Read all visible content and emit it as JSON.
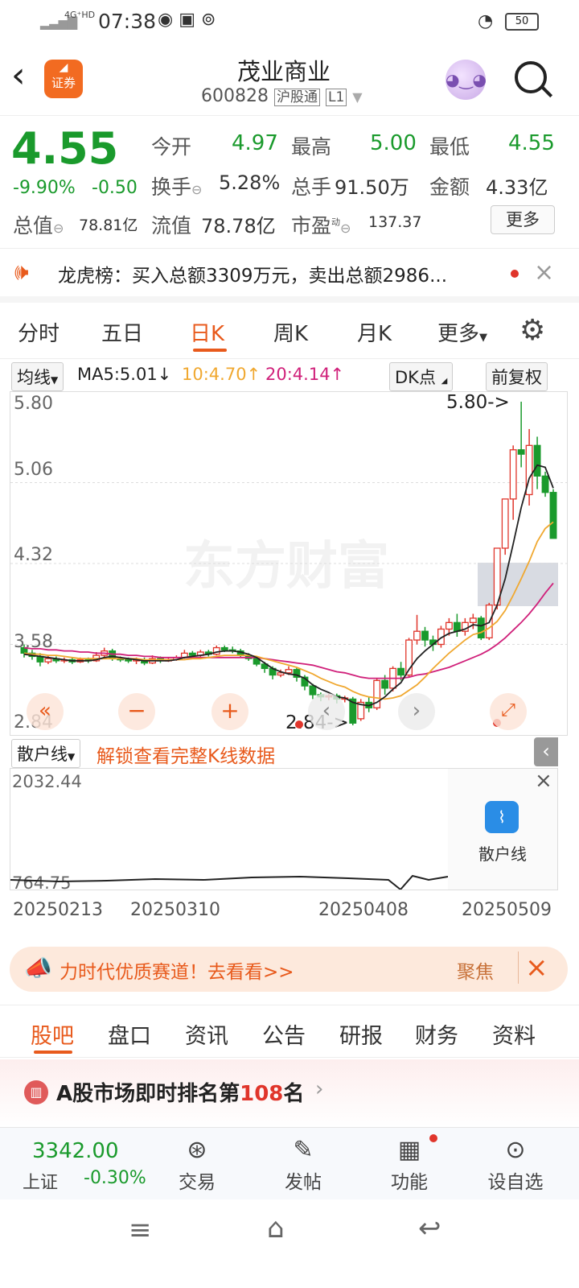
{
  "status_bar": {
    "network": "4G⁺HD",
    "time": "07:38",
    "battery": "50"
  },
  "header": {
    "title": "茂业商业",
    "code": "600828",
    "exchange_tag": "沪股通",
    "level_tag": "L1",
    "logo_label": "证券"
  },
  "quote": {
    "price": "4.55",
    "change_pct": "-9.90%",
    "change": "-0.50",
    "open_label": "今开",
    "open": "4.97",
    "high_label": "最高",
    "high": "5.00",
    "low_label": "最低",
    "low": "4.55",
    "turnover_label": "换手",
    "turnover": "5.28%",
    "volume_label": "总手",
    "volume": "91.50万",
    "amount_label": "金额",
    "amount": "4.33亿",
    "mcap_label": "总值",
    "mcap": "78.81亿",
    "float_label": "流值",
    "float": "78.78亿",
    "pe_label": "市盈",
    "pe_sup": "动",
    "pe": "137.37",
    "more_button": "更多"
  },
  "news": {
    "text": "龙虎榜：买入总额3309万元，卖出总额2986..."
  },
  "chart_tabs": [
    "分时",
    "五日",
    "日K",
    "周K",
    "月K",
    "更多"
  ],
  "active_chart_tab": "日K",
  "ma_row": {
    "selector": "均线",
    "ma5": "MA5:5.01↓",
    "ma10": "10:4.70↑",
    "ma20": "20:4.14↑",
    "dk": "DK点",
    "adjust": "前复权"
  },
  "colors": {
    "up": "#e0352b",
    "down": "#1a9a2c",
    "ma5": "#222222",
    "ma10": "#f0a830",
    "ma20": "#d0207a",
    "accent": "#e85a1c"
  },
  "kline": {
    "y_ticks": [
      "5.80",
      "5.06",
      "4.32",
      "3.58",
      "2.84"
    ],
    "watermark": "东方财富",
    "high_marker": "5.80->",
    "low_marker": "2.84->"
  },
  "chart_data": {
    "type": "candlestick",
    "ylim": [
      2.84,
      5.8
    ],
    "candles": [
      [
        3.55,
        3.5,
        3.58,
        3.46
      ],
      [
        3.5,
        3.47,
        3.53,
        3.44
      ],
      [
        3.47,
        3.42,
        3.5,
        3.38
      ],
      [
        3.42,
        3.45,
        3.48,
        3.4
      ],
      [
        3.45,
        3.43,
        3.47,
        3.41
      ],
      [
        3.43,
        3.44,
        3.46,
        3.41
      ],
      [
        3.44,
        3.42,
        3.46,
        3.4
      ],
      [
        3.42,
        3.44,
        3.46,
        3.41
      ],
      [
        3.44,
        3.43,
        3.46,
        3.41
      ],
      [
        3.43,
        3.48,
        3.51,
        3.42
      ],
      [
        3.48,
        3.52,
        3.55,
        3.46
      ],
      [
        3.52,
        3.45,
        3.54,
        3.43
      ],
      [
        3.45,
        3.44,
        3.47,
        3.42
      ],
      [
        3.44,
        3.43,
        3.46,
        3.41
      ],
      [
        3.43,
        3.44,
        3.46,
        3.4
      ],
      [
        3.44,
        3.41,
        3.46,
        3.39
      ],
      [
        3.41,
        3.45,
        3.48,
        3.4
      ],
      [
        3.45,
        3.43,
        3.47,
        3.41
      ],
      [
        3.43,
        3.44,
        3.46,
        3.42
      ],
      [
        3.44,
        3.46,
        3.48,
        3.43
      ],
      [
        3.46,
        3.5,
        3.53,
        3.45
      ],
      [
        3.5,
        3.48,
        3.52,
        3.46
      ],
      [
        3.48,
        3.51,
        3.53,
        3.46
      ],
      [
        3.51,
        3.49,
        3.53,
        3.47
      ],
      [
        3.49,
        3.55,
        3.57,
        3.48
      ],
      [
        3.55,
        3.53,
        3.57,
        3.51
      ],
      [
        3.53,
        3.52,
        3.56,
        3.5
      ],
      [
        3.52,
        3.48,
        3.54,
        3.46
      ],
      [
        3.48,
        3.45,
        3.5,
        3.43
      ],
      [
        3.45,
        3.4,
        3.47,
        3.38
      ],
      [
        3.4,
        3.36,
        3.42,
        3.32
      ],
      [
        3.36,
        3.3,
        3.38,
        3.26
      ],
      [
        3.3,
        3.32,
        3.35,
        3.28
      ],
      [
        3.32,
        3.35,
        3.38,
        3.3
      ],
      [
        3.35,
        3.28,
        3.37,
        3.24
      ],
      [
        3.28,
        3.2,
        3.3,
        3.16
      ],
      [
        3.2,
        3.12,
        3.22,
        3.08
      ],
      [
        3.12,
        3.1,
        3.14,
        3.06
      ],
      [
        3.1,
        3.11,
        3.13,
        3.07
      ],
      [
        3.11,
        3.08,
        3.13,
        3.04
      ],
      [
        3.08,
        3.09,
        3.11,
        3.05
      ],
      [
        3.08,
        2.86,
        3.1,
        2.84
      ],
      [
        2.9,
        3.05,
        3.08,
        2.88
      ],
      [
        3.05,
        3.0,
        3.1,
        2.96
      ],
      [
        3.0,
        3.25,
        3.27,
        2.98
      ],
      [
        3.25,
        3.18,
        3.3,
        3.12
      ],
      [
        3.18,
        3.36,
        3.38,
        3.15
      ],
      [
        3.36,
        3.3,
        3.42,
        3.25
      ],
      [
        3.3,
        3.62,
        3.64,
        3.28
      ],
      [
        3.62,
        3.7,
        3.85,
        3.58
      ],
      [
        3.7,
        3.62,
        3.74,
        3.56
      ],
      [
        3.62,
        3.58,
        3.66,
        3.52
      ],
      [
        3.58,
        3.72,
        3.75,
        3.55
      ],
      [
        3.72,
        3.78,
        3.82,
        3.66
      ],
      [
        3.78,
        3.7,
        3.86,
        3.65
      ],
      [
        3.7,
        3.78,
        3.82,
        3.66
      ],
      [
        3.78,
        3.82,
        3.86,
        3.72
      ],
      [
        3.82,
        3.64,
        3.84,
        3.62
      ],
      [
        3.64,
        3.94,
        3.96,
        3.62
      ],
      [
        3.94,
        4.46,
        4.46,
        3.9
      ],
      [
        4.46,
        4.91,
        4.91,
        4.4
      ],
      [
        4.91,
        5.36,
        5.4,
        4.72
      ],
      [
        5.36,
        5.32,
        5.8,
        5.2
      ],
      [
        4.95,
        5.4,
        5.55,
        4.85
      ],
      [
        5.4,
        5.12,
        5.48,
        5.0
      ],
      [
        5.12,
        4.97,
        5.16,
        4.93
      ],
      [
        4.97,
        4.55,
        5.0,
        4.55
      ]
    ],
    "ma5": [
      3.49,
      3.48,
      3.47,
      3.46,
      3.45,
      3.44,
      3.43,
      3.43,
      3.43,
      3.44,
      3.46,
      3.47,
      3.46,
      3.45,
      3.44,
      3.43,
      3.43,
      3.43,
      3.43,
      3.44,
      3.46,
      3.47,
      3.48,
      3.49,
      3.51,
      3.52,
      3.52,
      3.51,
      3.49,
      3.46,
      3.41,
      3.36,
      3.33,
      3.31,
      3.3,
      3.27,
      3.21,
      3.17,
      3.14,
      3.1,
      3.09,
      3.05,
      3.03,
      3.02,
      3.05,
      3.1,
      3.17,
      3.23,
      3.35,
      3.45,
      3.52,
      3.58,
      3.64,
      3.68,
      3.7,
      3.72,
      3.76,
      3.75,
      3.78,
      3.94,
      4.18,
      4.5,
      4.83,
      5.1,
      5.22,
      5.2,
      5.01
    ],
    "ma10": [
      3.5,
      3.49,
      3.49,
      3.48,
      3.48,
      3.47,
      3.46,
      3.45,
      3.45,
      3.45,
      3.45,
      3.45,
      3.45,
      3.45,
      3.45,
      3.44,
      3.44,
      3.44,
      3.44,
      3.44,
      3.44,
      3.45,
      3.45,
      3.46,
      3.47,
      3.48,
      3.48,
      3.48,
      3.48,
      3.47,
      3.45,
      3.43,
      3.41,
      3.39,
      3.37,
      3.34,
      3.31,
      3.27,
      3.24,
      3.21,
      3.19,
      3.15,
      3.12,
      3.1,
      3.09,
      3.08,
      3.09,
      3.11,
      3.16,
      3.21,
      3.28,
      3.36,
      3.43,
      3.5,
      3.56,
      3.62,
      3.67,
      3.69,
      3.73,
      3.79,
      3.89,
      4.03,
      4.18,
      4.34,
      4.52,
      4.64,
      4.7
    ],
    "ma20": [
      3.55,
      3.54,
      3.54,
      3.53,
      3.53,
      3.52,
      3.52,
      3.51,
      3.51,
      3.5,
      3.5,
      3.49,
      3.49,
      3.48,
      3.48,
      3.47,
      3.47,
      3.46,
      3.46,
      3.46,
      3.46,
      3.46,
      3.46,
      3.46,
      3.46,
      3.46,
      3.46,
      3.46,
      3.46,
      3.46,
      3.45,
      3.44,
      3.43,
      3.42,
      3.41,
      3.4,
      3.39,
      3.37,
      3.35,
      3.33,
      3.32,
      3.3,
      3.28,
      3.27,
      3.27,
      3.27,
      3.27,
      3.27,
      3.28,
      3.3,
      3.31,
      3.33,
      3.35,
      3.37,
      3.4,
      3.43,
      3.46,
      3.49,
      3.53,
      3.58,
      3.64,
      3.71,
      3.78,
      3.86,
      3.95,
      4.05,
      4.14
    ]
  },
  "sub_chart": {
    "selector": "散户线",
    "unlock_text": "解锁查看完整K线数据",
    "y_max": "2032.44",
    "y_min": "764.75",
    "card_label": "散户线",
    "x_labels": [
      "20250213",
      "20250310",
      "20250408",
      "20250509"
    ]
  },
  "banner": {
    "text": "力时代优质赛道！去看看>>",
    "right_text": "聚焦"
  },
  "bottom_tabs": [
    "股吧",
    "盘口",
    "资讯",
    "公告",
    "研报",
    "财务",
    "资料"
  ],
  "rank": {
    "prefix": "A股市场即时排名第",
    "number": "108",
    "suffix": "名"
  },
  "bottom_bar": {
    "index_value": "3342.00",
    "index_name": "上证",
    "index_change": "-0.30%",
    "items": [
      "交易",
      "发帖",
      "功能",
      "设自选"
    ]
  }
}
